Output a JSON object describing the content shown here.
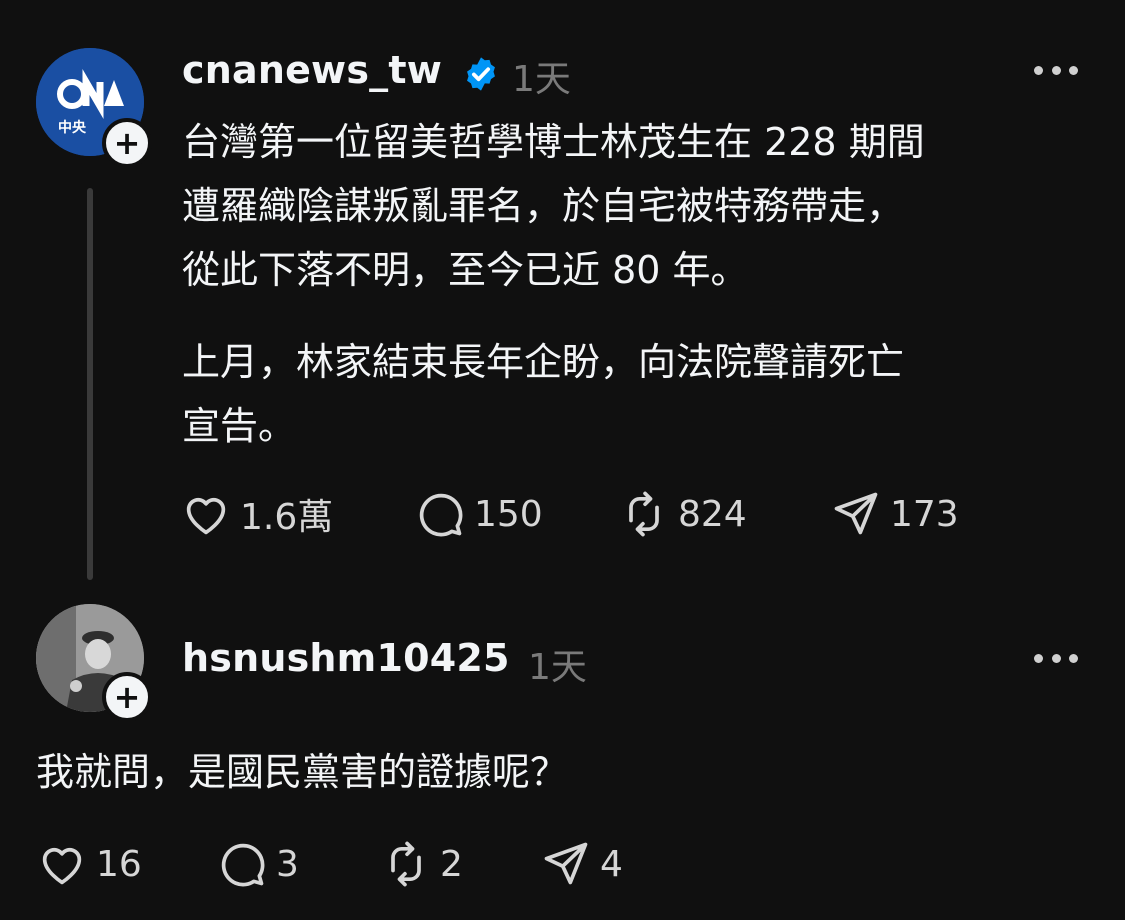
{
  "post": {
    "username": "cnanews_tw",
    "time": "1天",
    "avatar_text": "CNA",
    "avatar_sub": "中央",
    "paragraph1": "台灣第一位留美哲學博士林茂生在 228 期間\n遭羅織陰謀叛亂罪名，於自宅被特務帶走，\n從此下落不明，至今已近 80 年。",
    "paragraph2": "上月，林家結束長年企盼，向法院聲請死亡\n宣告。",
    "likes": "1.6萬",
    "comments": "150",
    "reposts": "824",
    "shares": "173"
  },
  "reply": {
    "username": "hsnushm10425",
    "time": "1天",
    "text": "我就問，是國民黨害的證據呢？",
    "likes": "16",
    "comments": "3",
    "reposts": "2",
    "shares": "4"
  },
  "colors": {
    "background": "#101010",
    "text": "#f3f5f7",
    "muted": "#7a7a7a",
    "verified": "#0095f6",
    "cna_blue": "#1a4fa3"
  },
  "icons": [
    "heart-icon",
    "comment-icon",
    "repost-icon",
    "share-icon",
    "verified-icon",
    "more-icon",
    "plus-icon"
  ]
}
